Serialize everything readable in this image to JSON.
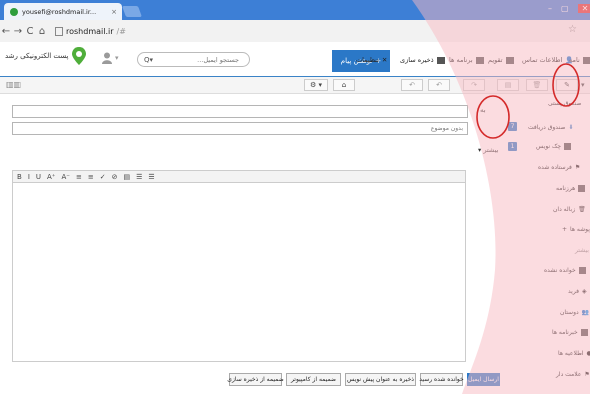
{
  "browser": {
    "tab_title": "yousefi@roshdmail.ir...",
    "tab_close": "×",
    "url_host": "roshdmail.ir",
    "url_hash": "/#",
    "win_min": "–",
    "win_max": "▢",
    "win_close": "✕"
  },
  "header": {
    "logo_text": "پست الکترونیکی رشد",
    "search_placeholder": "جستجو ایمیل...",
    "compose_label": "نوشتن پیام",
    "nav_settings": "تنظیمات",
    "nav_storage": "ذخیره سازی",
    "nav_programs": "برنامه ها",
    "nav_calendar": "تقویم",
    "nav_contacts": "اطلاعات تماس",
    "nav_mail": "نامه"
  },
  "compose": {
    "to_label": "به",
    "to_value": "",
    "subject_placeholder": "بدون موضوع",
    "more_label": "بیشتر"
  },
  "editor_toolbar": [
    "B",
    "I",
    "U",
    "A⁺",
    "A⁻",
    "≡",
    "≡",
    "✓",
    "⊘",
    "▤",
    "☰",
    "☰"
  ],
  "buttons": {
    "send": "ارسال ایمیل",
    "read_receipt": "خوانده شده رسید",
    "save_draft": "ذخیره به عنوان پیش نویس",
    "attach_computer": "ضمیمه از کامپیوتر",
    "attach_storage": "ضمیمه از ذخیره سازی"
  },
  "sidebar": {
    "header": "صندوق پستی",
    "inbox": "صندوق دریافت",
    "inbox_badge": "7",
    "drafts": "چک نویس",
    "drafts_badge": "1",
    "sent": "فرستاده شده",
    "spam": "هرزنامه",
    "trash": "زباله دان",
    "folders": "پوشه ها",
    "more": "بیشتر",
    "unread": "خوانده نشده",
    "flagged": "فرید",
    "friends": "دوستان",
    "newsletters": "خبرنامه ها",
    "alerts": "اطلاعیه ها",
    "tagged": "علامت دار"
  },
  "colors": {
    "accent": "#2b78c7",
    "overlay": "#f7b9c2",
    "annotation": "#d42a2a"
  }
}
